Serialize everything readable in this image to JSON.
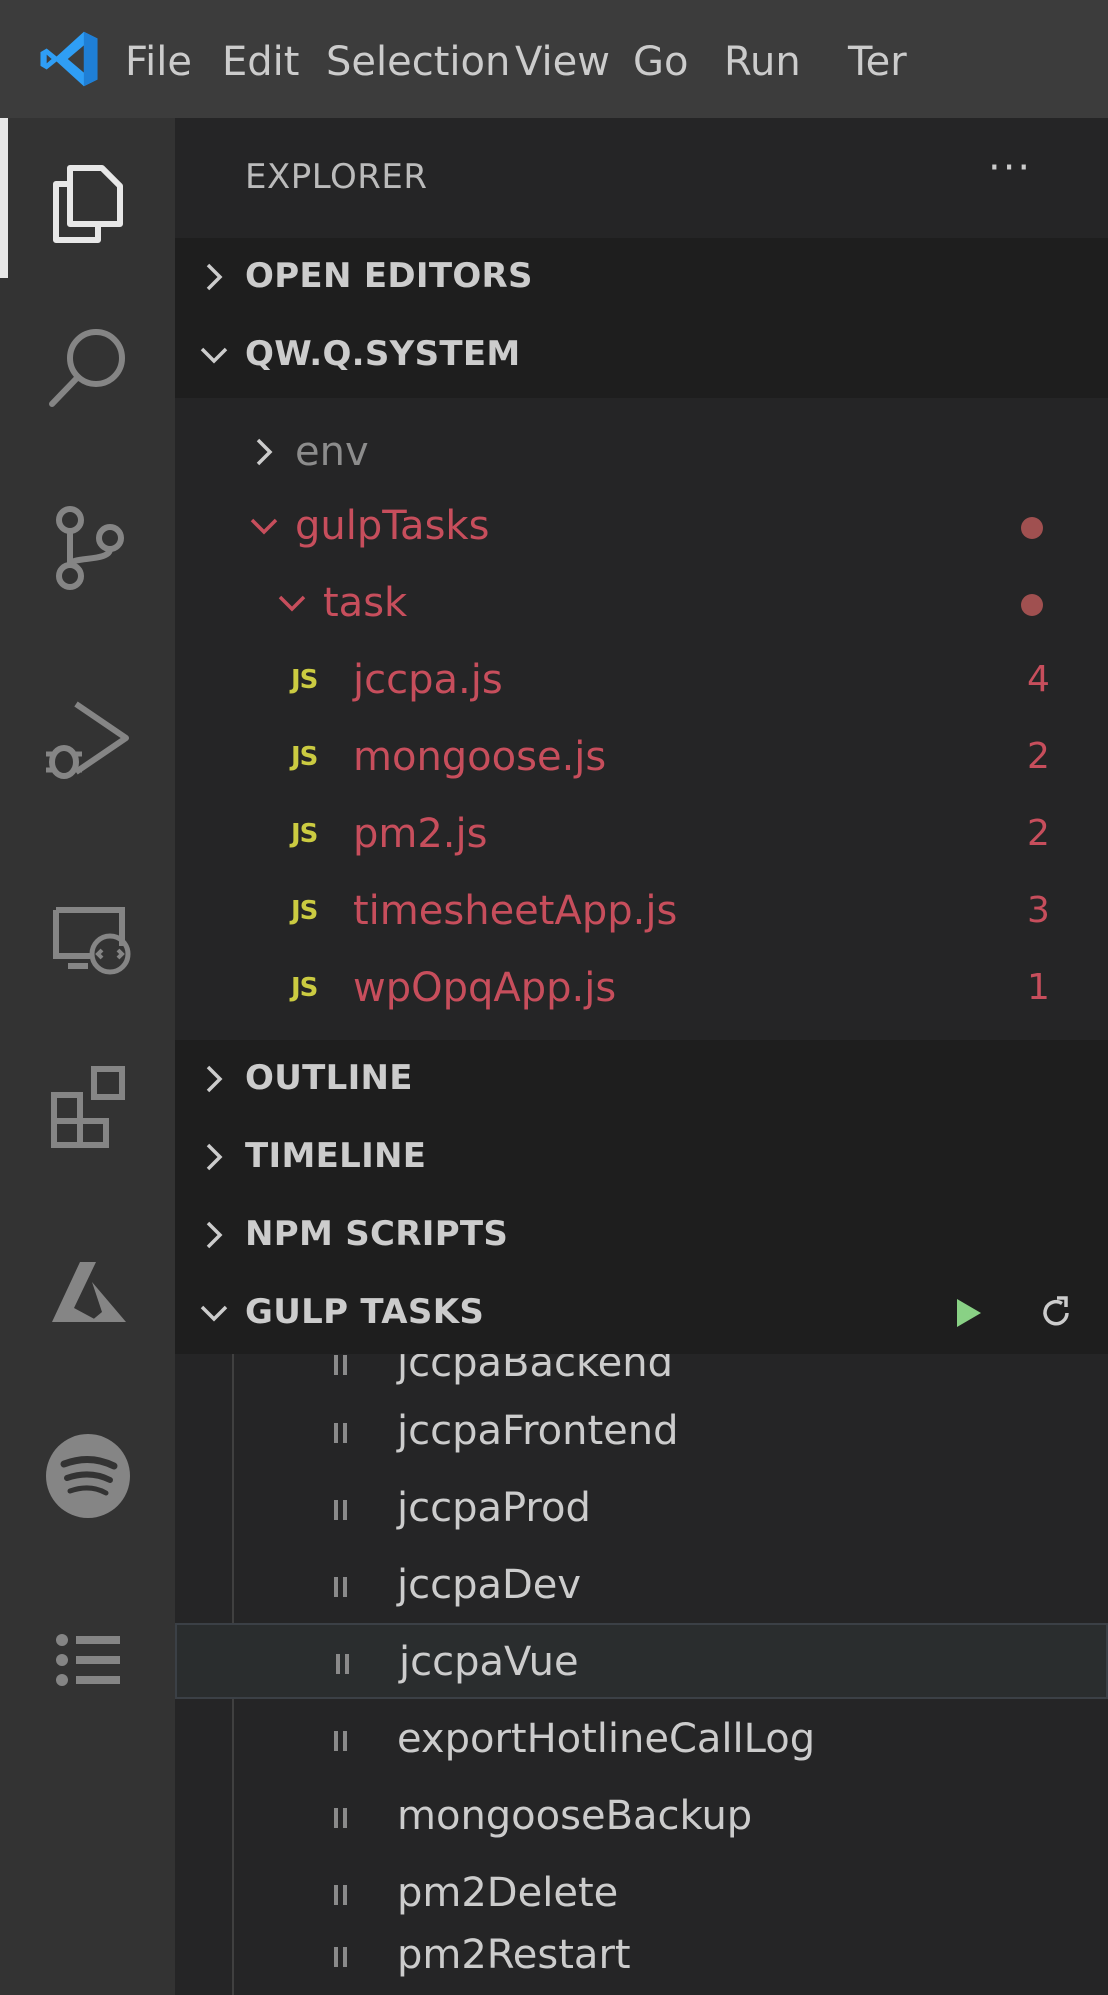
{
  "menubar": {
    "items": [
      "File",
      "Edit",
      "Selection",
      "View",
      "Go",
      "Run",
      "Ter"
    ]
  },
  "activitybar": {
    "icons": [
      "explorer-icon",
      "search-icon",
      "source-control-icon",
      "run-debug-icon",
      "remote-explorer-icon",
      "extensions-icon",
      "azure-icon",
      "spotify-icon",
      "list-icon"
    ]
  },
  "sidebar": {
    "title": "EXPLORER",
    "more": "···",
    "sections": {
      "open_editors": "OPEN EDITORS",
      "workspace": "QW.Q.SYSTEM",
      "outline": "OUTLINE",
      "timeline": "TIMELINE",
      "npm_scripts": "NPM SCRIPTS",
      "gulp_tasks": "GULP TASKS"
    },
    "tree": {
      "env": "env",
      "gulpTasks": "gulpTasks",
      "task": "task",
      "js_badge": "JS",
      "files": [
        {
          "name": "jccpa.js",
          "count": "4"
        },
        {
          "name": "mongoose.js",
          "count": "2"
        },
        {
          "name": "pm2.js",
          "count": "2"
        },
        {
          "name": "timesheetApp.js",
          "count": "3"
        },
        {
          "name": "wpOpqApp.js",
          "count": "1"
        }
      ]
    },
    "gulp_tasks": [
      "jccpaBackend",
      "jccpaFrontend",
      "jccpaProd",
      "jccpaDev",
      "jccpaVue",
      "exportHotlineCallLog",
      "mongooseBackup",
      "pm2Delete",
      "pm2Restart"
    ],
    "selected_task": "jccpaVue"
  },
  "colors": {
    "modified": "#c74e5c",
    "js_badge": "#cbcb41",
    "run_green": "#89d185"
  }
}
